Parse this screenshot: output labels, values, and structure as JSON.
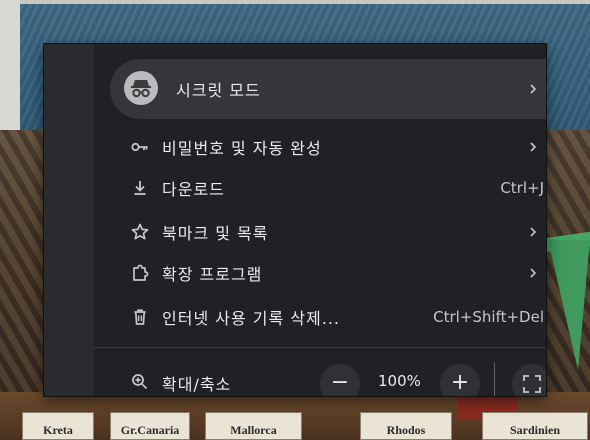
{
  "background": {
    "labels": [
      "Kreta",
      "Gr.Canaria",
      "Mallorca",
      "Rhodos",
      "Sardinien"
    ]
  },
  "menu": {
    "items": [
      {
        "id": "incognito",
        "label": "시크릿 모드",
        "icon": "incognito-icon",
        "has_submenu": true
      },
      {
        "id": "passwords",
        "label": "비밀번호 및 자동 완성",
        "icon": "key-icon",
        "has_submenu": true
      },
      {
        "id": "downloads",
        "label": "다운로드",
        "icon": "download-icon",
        "shortcut": "Ctrl+J"
      },
      {
        "id": "bookmarks",
        "label": "북마크 및 목록",
        "icon": "star-icon",
        "has_submenu": true
      },
      {
        "id": "extensions",
        "label": "확장 프로그램",
        "icon": "puzzle-icon",
        "has_submenu": true
      },
      {
        "id": "clear_history",
        "label": "인터넷 사용 기록 삭제...",
        "icon": "trash-icon",
        "shortcut": "Ctrl+Shift+Del"
      }
    ],
    "zoom": {
      "label": "확대/축소",
      "icon": "zoom-icon",
      "minus": "−",
      "plus": "+",
      "value": "100%"
    }
  },
  "colors": {
    "menu_bg": "#202124",
    "highlight": "#35363a",
    "text": "#e8eaed"
  }
}
